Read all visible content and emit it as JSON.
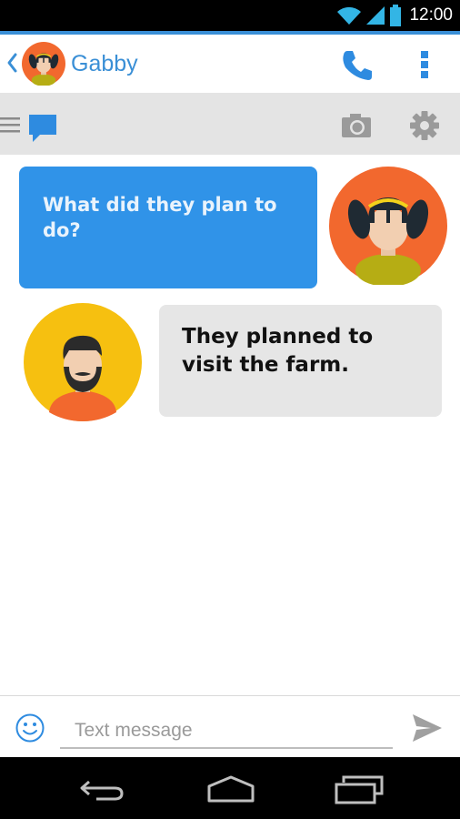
{
  "status_bar": {
    "time": "12:00"
  },
  "header": {
    "contact_name": "Gabby"
  },
  "composer": {
    "placeholder": "Text message"
  },
  "messages": [
    {
      "sender": "Gabby",
      "text": "What did they plan to do?"
    },
    {
      "sender": "me",
      "text": "They planned to visit the farm."
    }
  ],
  "icons": {
    "back": "chevron-left-icon",
    "call": "phone-icon",
    "menu": "overflow-menu-icon",
    "drawer": "hamburger-icon",
    "chat": "chat-bubble-icon",
    "camera": "camera-icon",
    "settings": "gear-icon",
    "emoji": "smiley-icon",
    "send": "send-icon"
  },
  "colors": {
    "accent": "#3a8fd6",
    "incoming_bubble": "#3093e8",
    "outgoing_bubble": "#e6e6e6",
    "toolbar": "#e4e4e4"
  }
}
